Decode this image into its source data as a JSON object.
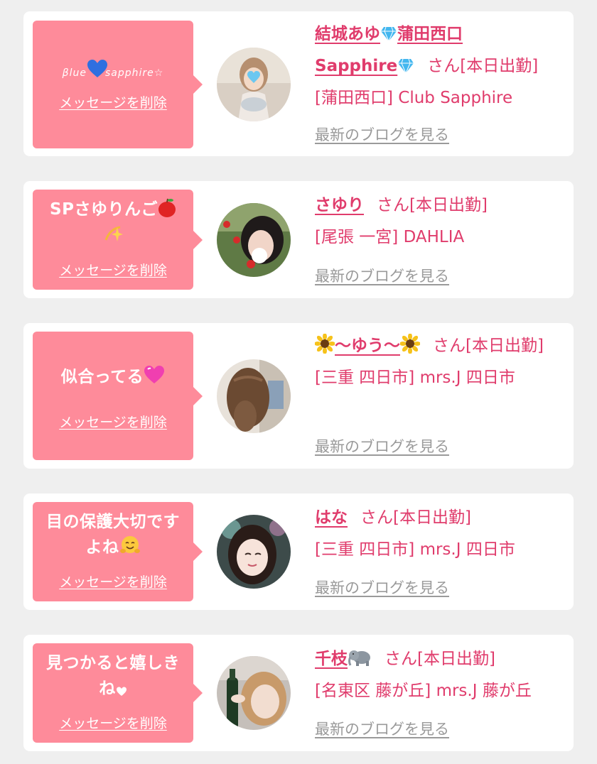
{
  "colors": {
    "background": "#efefef",
    "card": "#ffffff",
    "bubble": "#fe8b9a",
    "accent_text": "#e03c6c",
    "muted_link": "#9a9a9a"
  },
  "common": {
    "delete_label": "メッセージを削除",
    "blog_label": "最新のブログを見る",
    "san_label": "さん[本日出勤]"
  },
  "items": [
    {
      "message_parts": [
        "βlue",
        "sapphire☆"
      ],
      "message_icon": "blue-heart-icon",
      "name_parts": [
        "結城あゆ",
        "蒲田西口",
        "Sapphire"
      ],
      "name_icon": "gem-icon",
      "shop": "[蒲田西口] Club Sapphire"
    },
    {
      "message": "SPさゆりんご",
      "message_icons": [
        "apple-icon",
        "dizzy-icon"
      ],
      "name": "さゆり",
      "shop": "[尾張 一宮] DAHLIA"
    },
    {
      "message": "似合ってる",
      "message_icon": "pink-heart-icon",
      "name": "〜ゆう〜",
      "name_icon": "sunflower-icon",
      "shop": "[三重 四日市] mrs.J 四日市"
    },
    {
      "message_lines": [
        "目の保護大切です",
        "よね"
      ],
      "message_icon": "hugging-face-icon",
      "name": "はな",
      "shop": "[三重 四日市] mrs.J 四日市"
    },
    {
      "message_lines": [
        "見つかると嬉しき",
        "ね"
      ],
      "message_icon": "small-heart-icon",
      "name": "千枝",
      "name_icon": "elephant-icon",
      "shop": "[名東区 藤が丘] mrs.J 藤が丘"
    }
  ]
}
